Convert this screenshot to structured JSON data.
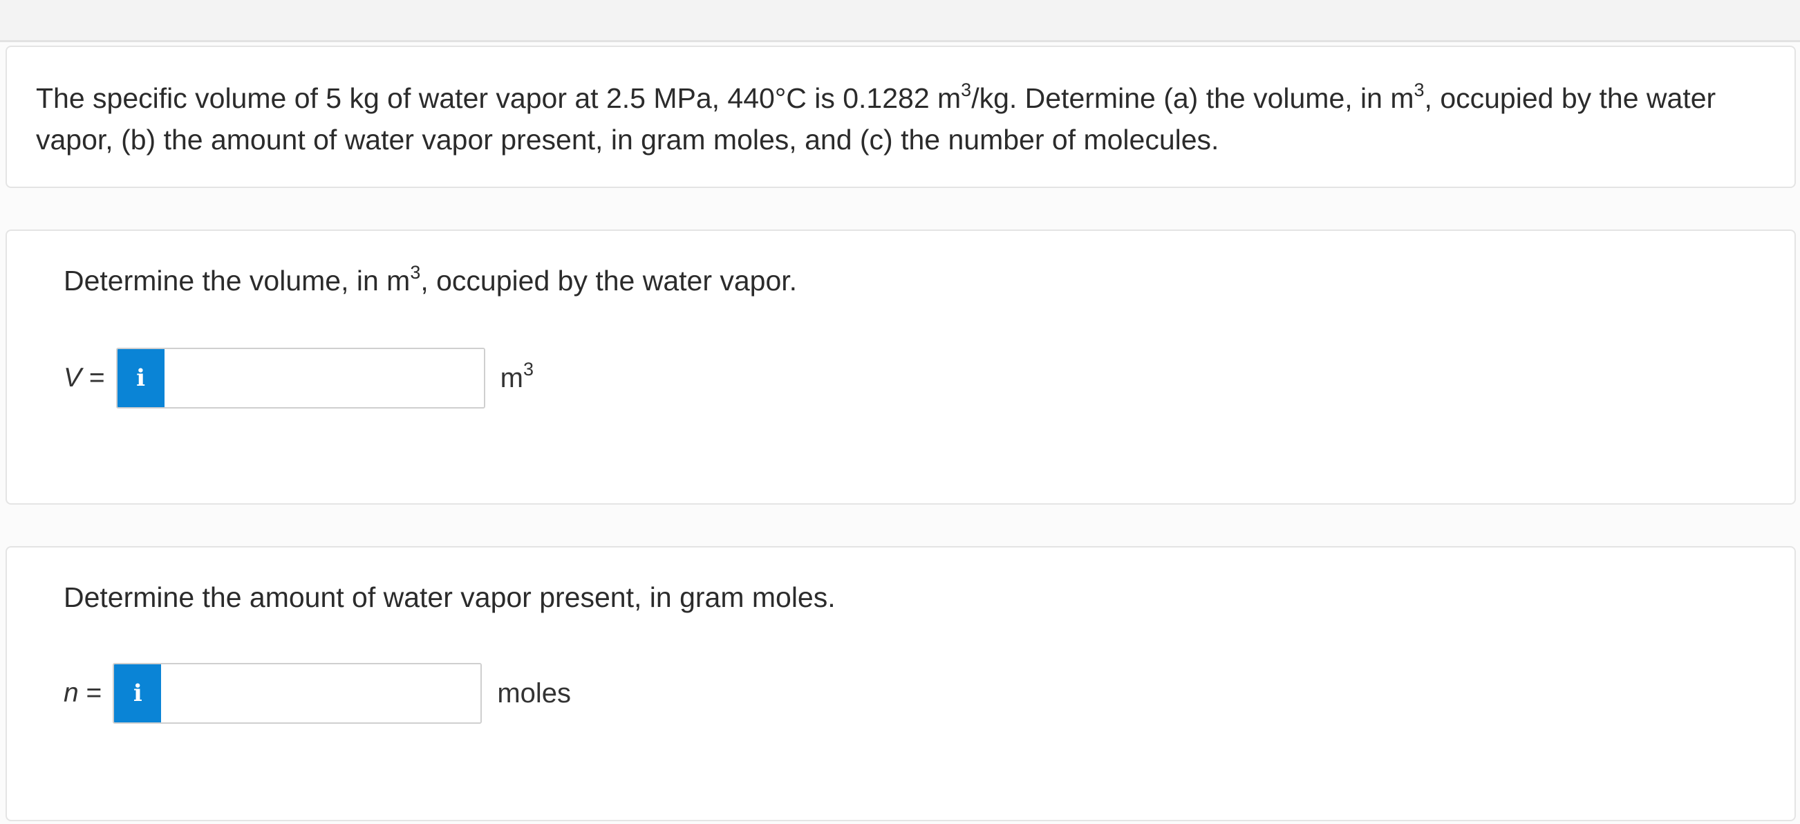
{
  "problem": {
    "text_before_sup1": "The specific volume of 5 kg of water vapor at 2.5 MPa, 440°C is 0.1282 m",
    "sup1": "3",
    "text_mid": "/kg. Determine (a) the volume, in m",
    "sup2": "3",
    "text_after": ", occupied by the water vapor, (b) the amount of water vapor present, in gram moles, and (c) the number of molecules."
  },
  "part1": {
    "question_before": "Determine the volume, in m",
    "question_sup": "3",
    "question_after": ", occupied by the water vapor.",
    "variable": "V",
    "equals": "=",
    "info_icon": "info-icon",
    "input_value": "",
    "unit_base": "m",
    "unit_sup": "3"
  },
  "part2": {
    "question": "Determine the amount of water vapor present, in gram moles.",
    "variable": "n",
    "equals": "=",
    "info_icon": "info-icon",
    "input_value": "",
    "unit": "moles"
  },
  "colors": {
    "info_button": "#0a84d6",
    "card_border": "#e4e4e4",
    "text": "#2b2b2b"
  }
}
